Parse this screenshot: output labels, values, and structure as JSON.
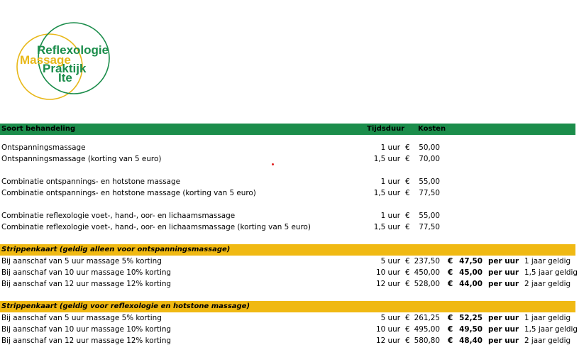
{
  "logo": {
    "line1": "Reflexologie",
    "line2": "Massage",
    "line3": "Praktijk",
    "line4": "Ite",
    "green": "#1b8d4b",
    "yellow": "#e8b819"
  },
  "header": {
    "col_treatment": "Soort behandeling",
    "col_duration": "Tijdsduur",
    "col_cost": "Kosten",
    "bg": "#1b8d4b"
  },
  "currency": "€",
  "treatments": [
    {
      "name": "Ontspanningsmassage",
      "duration": "1 uur",
      "price": "50,00"
    },
    {
      "name": "Ontspanningsmassage (korting van 5 euro)",
      "duration": "1,5 uur",
      "price": "70,00"
    },
    {
      "name": "Combinatie ontspannings- en hotstone massage",
      "duration": "1 uur",
      "price": "55,00"
    },
    {
      "name": "Combinatie ontspannings- en hotstone massage (korting van 5 euro)",
      "duration": "1,5 uur",
      "price": "77,50"
    },
    {
      "name": "Combinatie reflexologie voet-, hand-, oor- en lichaamsmassage",
      "duration": "1 uur",
      "price": "55,00"
    },
    {
      "name": "Combinatie reflexologie voet-, hand-, oor- en lichaamsmassage (korting van 5 euro)",
      "duration": "1,5 uur",
      "price": "77,50"
    }
  ],
  "strip1": {
    "title": "Strippenkaart (geldig alleen voor ontspanningsmassage)",
    "rows": [
      {
        "name": "Bij aanschaf van 5 uur massage 5% korting",
        "duration": "5 uur",
        "price": "237,50",
        "hourly": "47,50",
        "per": "per uur",
        "valid": "1 jaar geldig"
      },
      {
        "name": "Bij aanschaf van 10 uur massage 10% korting",
        "duration": "10 uur",
        "price": "450,00",
        "hourly": "45,00",
        "per": "per uur",
        "valid": "1,5 jaar geldig"
      },
      {
        "name": "Bij aanschaf van 12 uur massage 12% korting",
        "duration": "12 uur",
        "price": "528,00",
        "hourly": "44,00",
        "per": "per uur",
        "valid": "2 jaar geldig"
      }
    ]
  },
  "strip2": {
    "title": "Strippenkaart (geldig voor reflexologie en hotstone massage)",
    "rows": [
      {
        "name": "Bij aanschaf van 5 uur massage 5% korting",
        "duration": "5 uur",
        "price": "261,25",
        "hourly": "52,25",
        "per": "per uur",
        "valid": "1 jaar geldig"
      },
      {
        "name": "Bij aanschaf van 10 uur massage 10% korting",
        "duration": "10 uur",
        "price": "495,00",
        "hourly": "49,50",
        "per": "per uur",
        "valid": "1,5 jaar geldig"
      },
      {
        "name": "Bij aanschaf van 12 uur massage 12% korting",
        "duration": "12 uur",
        "price": "580,80",
        "hourly": "48,40",
        "per": "per uur",
        "valid": "2 jaar geldig"
      }
    ]
  }
}
